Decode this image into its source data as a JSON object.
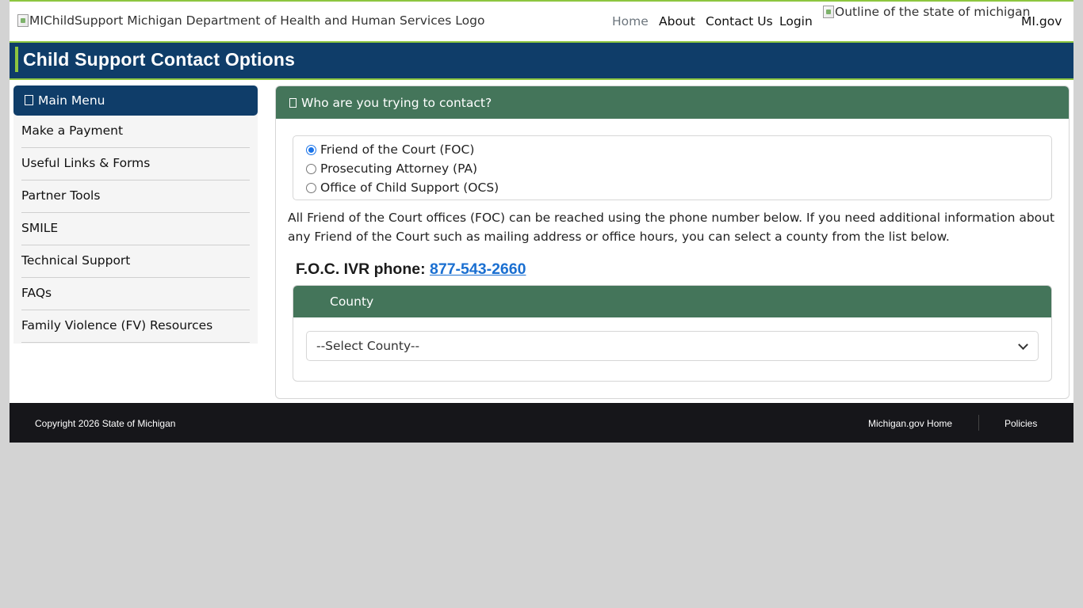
{
  "header": {
    "logo_alt": "MIChildSupport Michigan Department of Health and Human Services Logo",
    "nav": {
      "home": "Home",
      "about": "About",
      "contact": "Contact Us",
      "login": "Login"
    },
    "state_alt": "Outline of the state of michigan",
    "migov": "MI.gov"
  },
  "page_title": "Child Support Contact Options",
  "sidebar": {
    "heading": "Main Menu",
    "items": [
      "Make a Payment",
      "Useful Links & Forms",
      "Partner Tools",
      "SMILE",
      "Technical Support",
      "FAQs",
      "Family Violence (FV) Resources"
    ]
  },
  "contact": {
    "heading": "Who are you trying to contact?",
    "options": [
      {
        "label": "Friend of the Court (FOC)",
        "selected": true
      },
      {
        "label": "Prosecuting Attorney (PA)",
        "selected": false
      },
      {
        "label": "Office of Child Support (OCS)",
        "selected": false
      }
    ],
    "info": "All Friend of the Court offices (FOC) can be reached using the phone number below. If you need additional information about any Friend of the Court such as mailing address or office hours, you can select a county from the list below.",
    "ivr_label": "F.O.C. IVR phone:",
    "ivr_phone": "877-543-2660"
  },
  "county": {
    "heading": "County",
    "selected": "--Select County--"
  },
  "footer": {
    "copyright": "Copyright 2026 State of Michigan",
    "home_link": "Michigan.gov Home",
    "policies": "Policies"
  },
  "colors": {
    "navy": "#0f3d69",
    "green_header": "#44755a",
    "accent_green": "#8dc63f",
    "link_blue": "#1a6fd1",
    "footer_bg": "#16161a"
  }
}
